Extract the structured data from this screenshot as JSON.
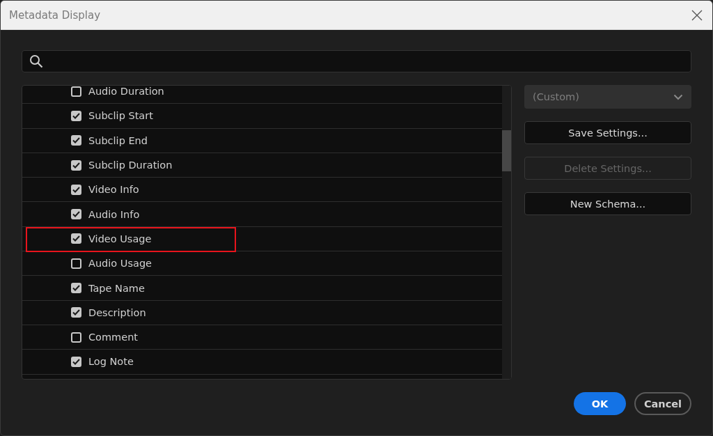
{
  "window": {
    "title": "Metadata Display"
  },
  "fields": [
    {
      "label": "Audio Duration",
      "checked": false,
      "highlighted": false
    },
    {
      "label": "Subclip Start",
      "checked": true,
      "highlighted": false
    },
    {
      "label": "Subclip End",
      "checked": true,
      "highlighted": false
    },
    {
      "label": "Subclip Duration",
      "checked": true,
      "highlighted": false
    },
    {
      "label": "Video Info",
      "checked": true,
      "highlighted": false
    },
    {
      "label": "Audio Info",
      "checked": true,
      "highlighted": false
    },
    {
      "label": "Video Usage",
      "checked": true,
      "highlighted": true
    },
    {
      "label": "Audio Usage",
      "checked": false,
      "highlighted": false
    },
    {
      "label": "Tape Name",
      "checked": true,
      "highlighted": false
    },
    {
      "label": "Description",
      "checked": true,
      "highlighted": false
    },
    {
      "label": "Comment",
      "checked": false,
      "highlighted": false
    },
    {
      "label": "Log Note",
      "checked": true,
      "highlighted": false
    }
  ],
  "preset": {
    "value": "(Custom)"
  },
  "side_buttons": [
    {
      "label": "Save Settings...",
      "disabled": false
    },
    {
      "label": "Delete Settings...",
      "disabled": true
    },
    {
      "label": "New Schema...",
      "disabled": false
    }
  ],
  "footer_buttons": [
    {
      "label": "OK",
      "kind": "primary"
    },
    {
      "label": "Cancel",
      "kind": "secondary"
    }
  ]
}
